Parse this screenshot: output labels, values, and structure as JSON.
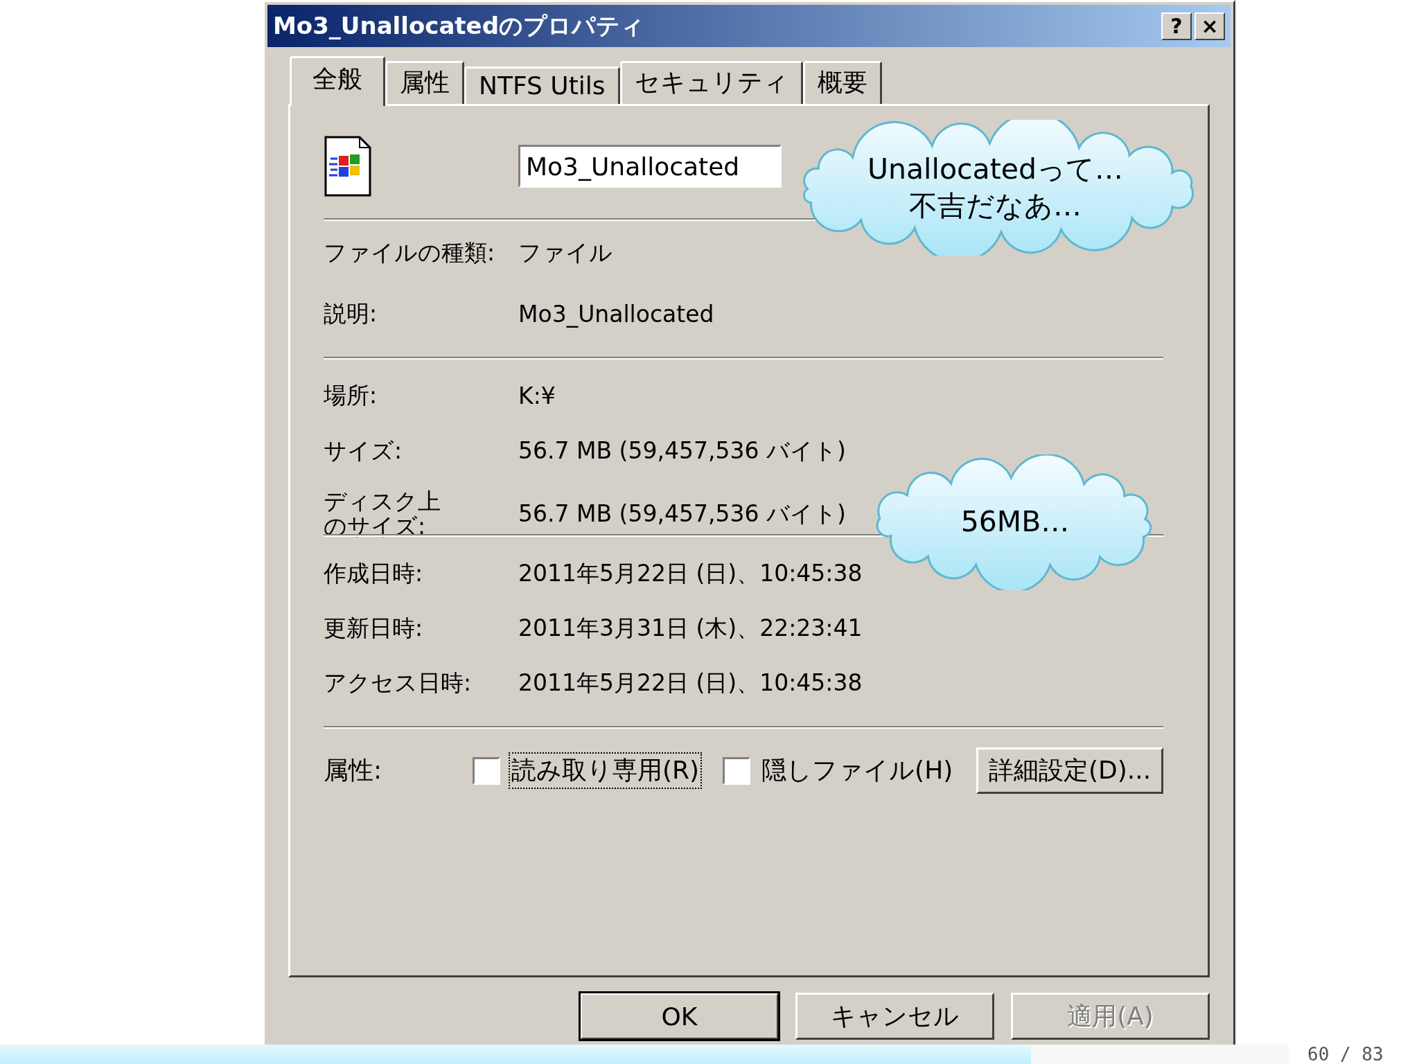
{
  "dialog": {
    "title": "Mo3_Unallocatedのプロパティ",
    "title_buttons": [
      "?",
      "×"
    ]
  },
  "tabs": [
    {
      "label": "全般",
      "selected": true
    },
    {
      "label": "属性",
      "selected": false
    },
    {
      "label": "NTFS Utils",
      "selected": false
    },
    {
      "label": "セキュリティ",
      "selected": false
    },
    {
      "label": "概要",
      "selected": false
    }
  ],
  "file": {
    "name": "Mo3_Unallocated"
  },
  "groups": [
    [
      {
        "label": "ファイルの種類:",
        "value": "ファイル"
      },
      {
        "label": "説明:",
        "value": "Mo3_Unallocated"
      }
    ],
    [
      {
        "label": "場所:",
        "value": "K:¥"
      },
      {
        "label": "サイズ:",
        "value": "56.7 MB (59,457,536 バイト)"
      },
      {
        "label": "ディスク上のサイズ:",
        "value": "56.7 MB (59,457,536 バイト)"
      }
    ],
    [
      {
        "label": "作成日時:",
        "value": "2011年5月22日 (日)、10:45:38"
      },
      {
        "label": "更新日時:",
        "value": "2011年3月31日 (木)、22:23:41"
      },
      {
        "label": "アクセス日時:",
        "value": "2011年5月22日 (日)、10:45:38"
      }
    ]
  ],
  "attributes": {
    "label": "属性:",
    "checkboxes": [
      {
        "label": "読み取り専用(R)",
        "checked": false,
        "focused": true
      },
      {
        "label": "隠しファイル(H)",
        "checked": false,
        "focused": false
      }
    ],
    "advanced_button": "詳細設定(D)..."
  },
  "buttons": [
    {
      "label": "OK",
      "default": true,
      "disabled": false
    },
    {
      "label": "キャンセル",
      "default": false,
      "disabled": false
    },
    {
      "label": "適用(A)",
      "default": false,
      "disabled": true
    }
  ],
  "callouts": [
    {
      "text": "Unallocatedって…\n不吉だなあ…"
    },
    {
      "text": "56MB…"
    }
  ],
  "slide": {
    "progress": {
      "level": 0.8
    },
    "page": "60 / 83"
  }
}
